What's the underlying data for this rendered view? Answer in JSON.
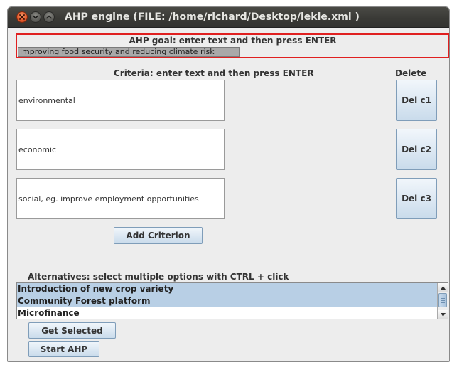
{
  "window": {
    "title": "AHP engine  (FILE: /home/richard/Desktop/lekie.xml )"
  },
  "goal": {
    "label": "AHP goal: enter text and then press ENTER",
    "value": "improving food security and reducing climate risk"
  },
  "criteria": {
    "label": "Criteria: enter text and then press ENTER",
    "delete_header": "Delete",
    "items": [
      {
        "value": "environmental",
        "delete_label": "Del c1"
      },
      {
        "value": "economic",
        "delete_label": "Del c2"
      },
      {
        "value": "social, eg. improve employment opportunities",
        "delete_label": "Del c3"
      }
    ],
    "add_label": "Add Criterion"
  },
  "alternatives": {
    "label": "Alternatives: select multiple options with CTRL + click",
    "items": [
      {
        "label": "Introduction of new crop variety",
        "selected": true
      },
      {
        "label": "Community Forest platform",
        "selected": true
      },
      {
        "label": "Microfinance",
        "selected": false
      }
    ],
    "get_selected_label": "Get Selected",
    "start_label": "Start AHP"
  },
  "colors": {
    "goal_border": "#e02020",
    "selection": "#b8cfe5",
    "button_border": "#7f9db9"
  }
}
